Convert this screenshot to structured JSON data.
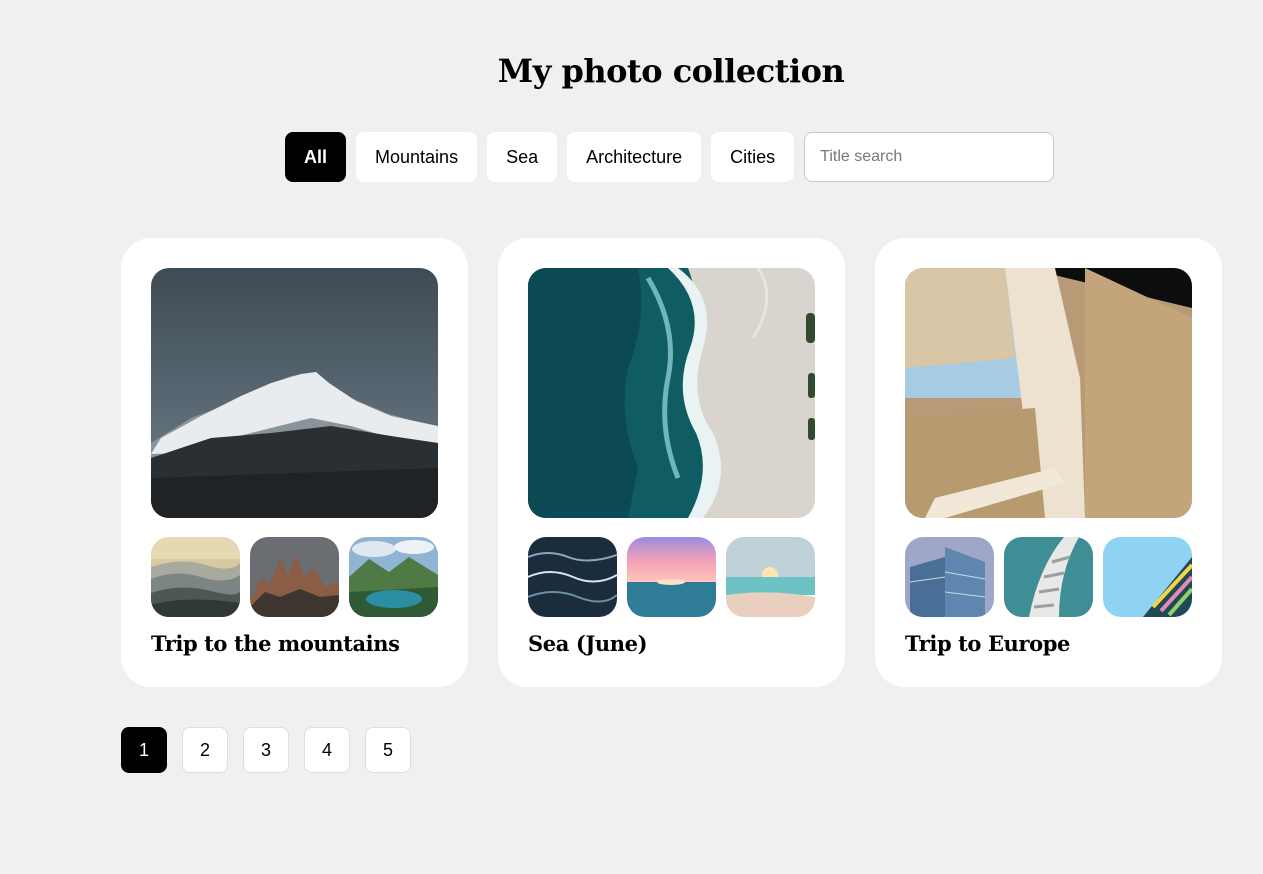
{
  "header": {
    "title": "My photo collection"
  },
  "filters": {
    "categories": [
      {
        "label": "All",
        "active": true
      },
      {
        "label": "Mountains",
        "active": false
      },
      {
        "label": "Sea",
        "active": false
      },
      {
        "label": "Architecture",
        "active": false
      },
      {
        "label": "Cities",
        "active": false
      }
    ],
    "search": {
      "placeholder": "Title search",
      "value": ""
    }
  },
  "collections": [
    {
      "title": "Trip to the mountains",
      "main_photo": "snowy-mountain-peak-photo",
      "thumbnails": [
        "misty-hills-sunset-photo",
        "rocky-peaks-photo",
        "alpine-lake-photo"
      ]
    },
    {
      "title": "Sea (June)",
      "main_photo": "aerial-beach-waves-photo",
      "thumbnails": [
        "dark-sea-waves-photo",
        "pink-sunset-sea-photo",
        "beach-sunrise-photo"
      ]
    },
    {
      "title": "Trip to Europe",
      "main_photo": "modern-architecture-photo",
      "thumbnails": [
        "glass-skyscrapers-photo",
        "curved-building-facade-photo",
        "colorful-balconies-photo"
      ]
    }
  ],
  "pagination": {
    "pages": [
      "1",
      "2",
      "3",
      "4",
      "5"
    ],
    "current": "1"
  },
  "colors": {
    "background": "#eef0f2",
    "active": "#000000",
    "card": "#ffffff"
  }
}
